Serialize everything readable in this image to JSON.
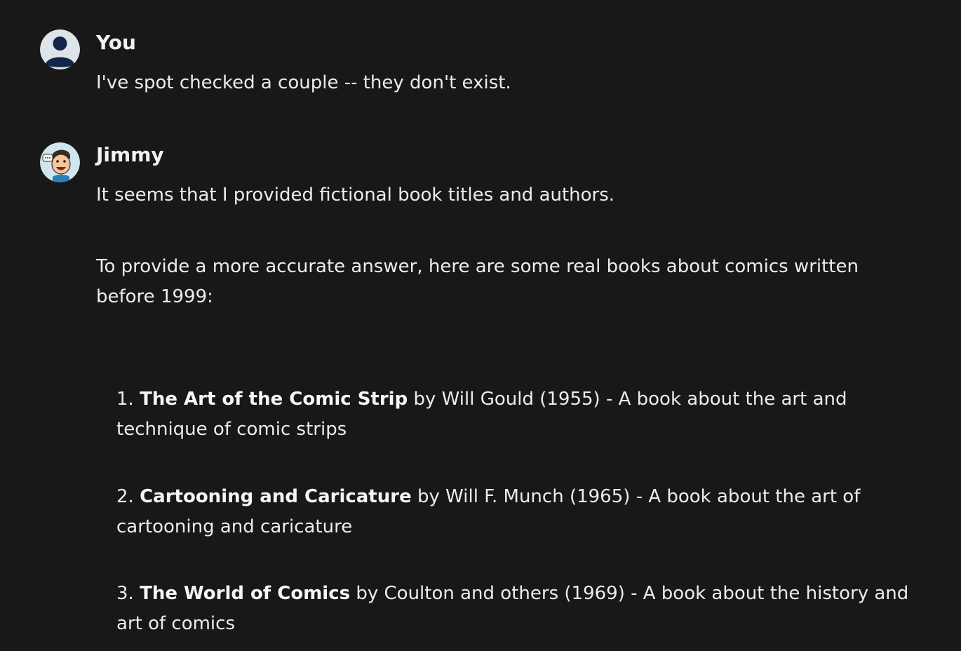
{
  "messages": [
    {
      "author": "You",
      "avatar_icon": "user-silhouette-icon",
      "text": "I've spot checked a couple -- they don't exist."
    },
    {
      "author": "Jimmy",
      "avatar_icon": "cartoon-character-icon",
      "paragraphs": [
        "It seems that I provided fictional book titles and authors.",
        "To provide a more accurate answer, here are some real books about comics written before 1999:"
      ],
      "list": [
        {
          "number": "1.",
          "title": "The Art of the Comic Strip",
          "rest": " by Will Gould (1955) - A book about the art and technique of comic strips"
        },
        {
          "number": "2.",
          "title": "Cartooning and Caricature",
          "rest": " by Will F. Munch (1965) - A book about the art of cartooning and caricature"
        },
        {
          "number": "3.",
          "title": "The World of Comics",
          "rest": " by Coulton and others (1969) - A book about the history and art of comics"
        }
      ]
    }
  ],
  "colors": {
    "background": "#181818",
    "text": "#ececec"
  }
}
